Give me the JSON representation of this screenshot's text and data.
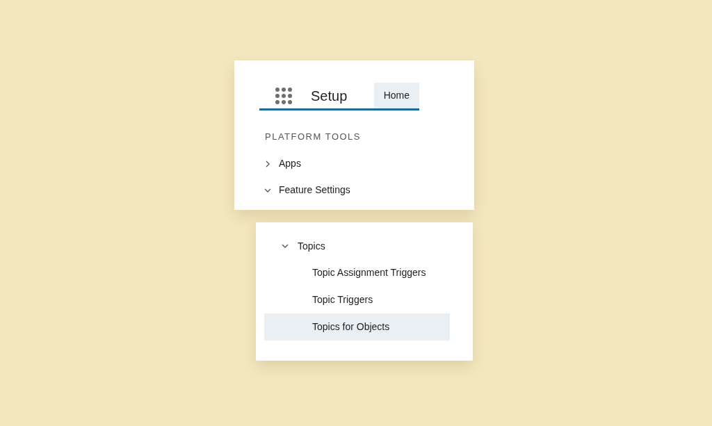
{
  "header": {
    "title": "Setup",
    "tabs": [
      {
        "label": "Home",
        "selected": true
      }
    ]
  },
  "section": {
    "heading": "PLATFORM TOOLS",
    "items": [
      {
        "label": "Apps",
        "expanded": false
      },
      {
        "label": "Feature Settings",
        "expanded": true
      }
    ]
  },
  "subtree": {
    "items": [
      {
        "label": "Topics",
        "expanded": true,
        "children": [
          {
            "label": "Topic Assignment Triggers",
            "selected": false
          },
          {
            "label": "Topic Triggers",
            "selected": false
          },
          {
            "label": "Topics for Objects",
            "selected": true
          }
        ]
      }
    ]
  }
}
